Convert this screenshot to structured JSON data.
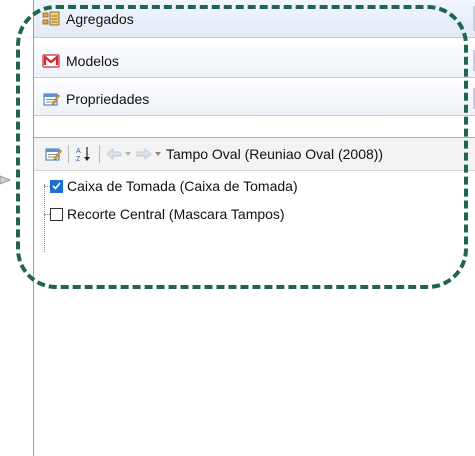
{
  "sections": [
    {
      "label": "Agregados",
      "icon": "aggregates-icon"
    },
    {
      "label": "Modelos",
      "icon": "models-icon"
    },
    {
      "label": "Propriedades",
      "icon": "properties-icon"
    }
  ],
  "toolbar": {
    "breadcrumb": "Tampo Oval (Reuniao Oval (2008))"
  },
  "tree": {
    "items": [
      {
        "label": "Caixa de Tomada (Caixa de Tomada)",
        "checked": true
      },
      {
        "label": "Recorte Central (Mascara Tampos)",
        "checked": false
      }
    ]
  },
  "colors": {
    "highlight_border": "#1f6553",
    "checkbox_checked": "#1b70d2",
    "models_icon": "#d3262e"
  }
}
